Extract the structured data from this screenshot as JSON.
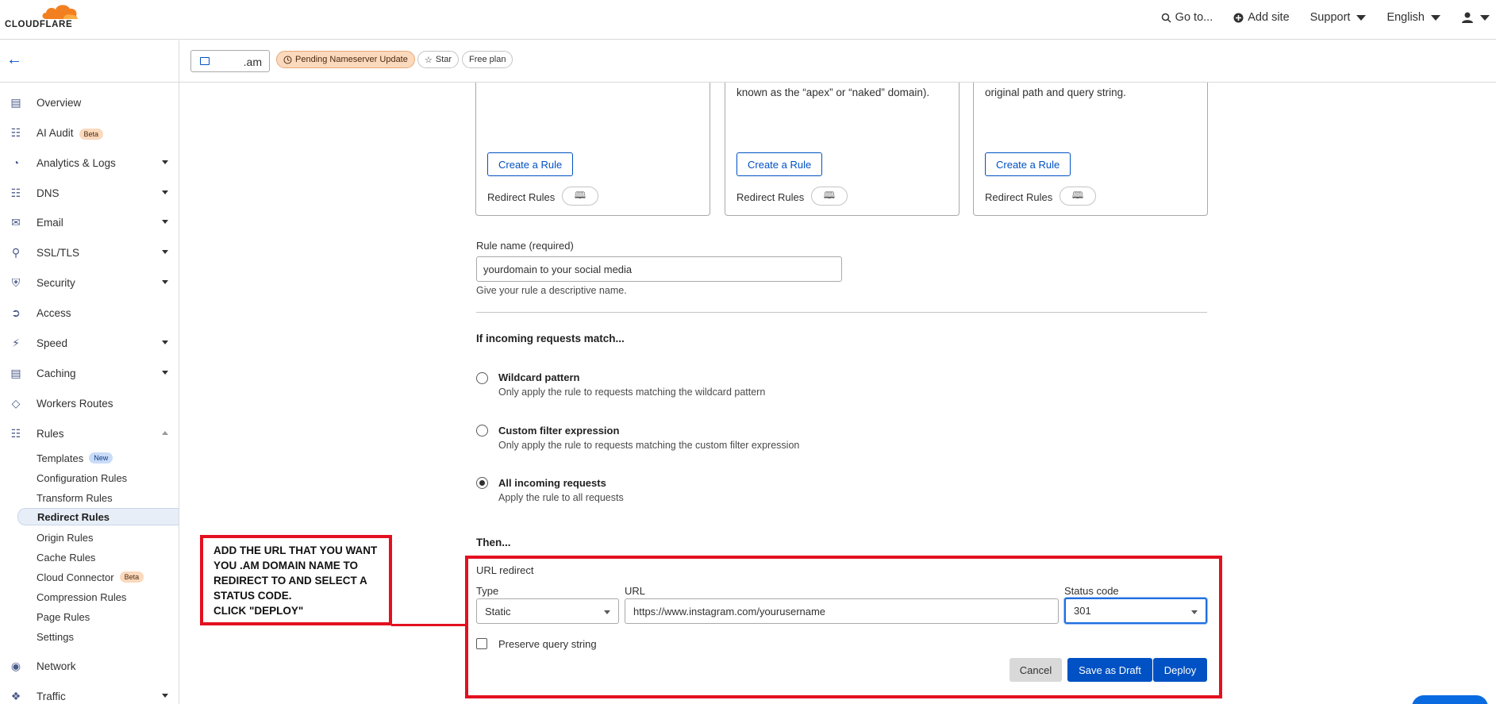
{
  "topbar": {
    "logo_text": "CLOUDFLARE",
    "goto": "Go to...",
    "add_site": "Add site",
    "support": "Support",
    "language": "English"
  },
  "subheader": {
    "domain": ".am",
    "pending_badge": "Pending Nameserver Update",
    "star": "Star",
    "plan": "Free plan"
  },
  "sidebar": {
    "items": [
      {
        "label": "Overview",
        "icon": "document-icon"
      },
      {
        "label": "AI Audit",
        "icon": "robot-icon",
        "badge": "Beta"
      },
      {
        "label": "Analytics & Logs",
        "icon": "chart-icon"
      },
      {
        "label": "DNS",
        "icon": "network-tree-icon"
      },
      {
        "label": "Email",
        "icon": "envelope-icon"
      },
      {
        "label": "SSL/TLS",
        "icon": "lock-icon"
      },
      {
        "label": "Security",
        "icon": "shield-icon"
      },
      {
        "label": "Access",
        "icon": "access-icon"
      },
      {
        "label": "Speed",
        "icon": "lightning-icon"
      },
      {
        "label": "Caching",
        "icon": "server-icon"
      },
      {
        "label": "Workers Routes",
        "icon": "workers-icon"
      },
      {
        "label": "Rules",
        "icon": "rules-icon"
      }
    ],
    "rules_sub": [
      {
        "label": "Templates",
        "badge": "New"
      },
      {
        "label": "Configuration Rules"
      },
      {
        "label": "Transform Rules"
      },
      {
        "label": "Redirect Rules"
      },
      {
        "label": "Origin Rules"
      },
      {
        "label": "Cache Rules"
      },
      {
        "label": "Cloud Connector",
        "badge": "Beta"
      },
      {
        "label": "Compression Rules"
      },
      {
        "label": "Page Rules"
      },
      {
        "label": "Settings"
      }
    ],
    "bottom": [
      {
        "label": "Network",
        "icon": "pin-icon"
      },
      {
        "label": "Traffic",
        "icon": "traffic-icon"
      }
    ]
  },
  "cards": [
    {
      "desc": "",
      "button": "Create a Rule",
      "link": "Redirect Rules"
    },
    {
      "desc": "known as the “apex” or “naked” domain).",
      "button": "Create a Rule",
      "link": "Redirect Rules"
    },
    {
      "desc": "original path and query string.",
      "button": "Create a Rule",
      "link": "Redirect Rules"
    }
  ],
  "form": {
    "rule_name_label": "Rule name (required)",
    "rule_name_value": "yourdomain to your social media",
    "rule_name_help": "Give your rule a descriptive name.",
    "match_heading": "If incoming requests match...",
    "options": [
      {
        "title": "Wildcard pattern",
        "desc": "Only apply the rule to requests matching the wildcard pattern",
        "selected": false
      },
      {
        "title": "Custom filter expression",
        "desc": "Only apply the rule to requests matching the custom filter expression",
        "selected": false
      },
      {
        "title": "All incoming requests",
        "desc": "Apply the rule to all requests",
        "selected": true
      }
    ],
    "then_heading": "Then...",
    "url_redirect_label": "URL redirect",
    "type_label": "Type",
    "type_value": "Static",
    "url_label": "URL",
    "url_value": "https://www.instagram.com/yourusername",
    "status_label": "Status code",
    "status_value": "301",
    "preserve_label": "Preserve query string",
    "cancel": "Cancel",
    "save_draft": "Save as Draft",
    "deploy": "Deploy"
  },
  "annotation": {
    "lines": [
      "ADD THE URL THAT YOU WANT",
      "YOU .AM DOMAIN NAME TO",
      "REDIRECT TO AND SELECT A",
      "STATUS CODE.",
      "CLICK \"DEPLOY\""
    ],
    "color": "#e3101f"
  },
  "colors": {
    "accent": "#0051c3",
    "brand_orange": "#f38020"
  }
}
